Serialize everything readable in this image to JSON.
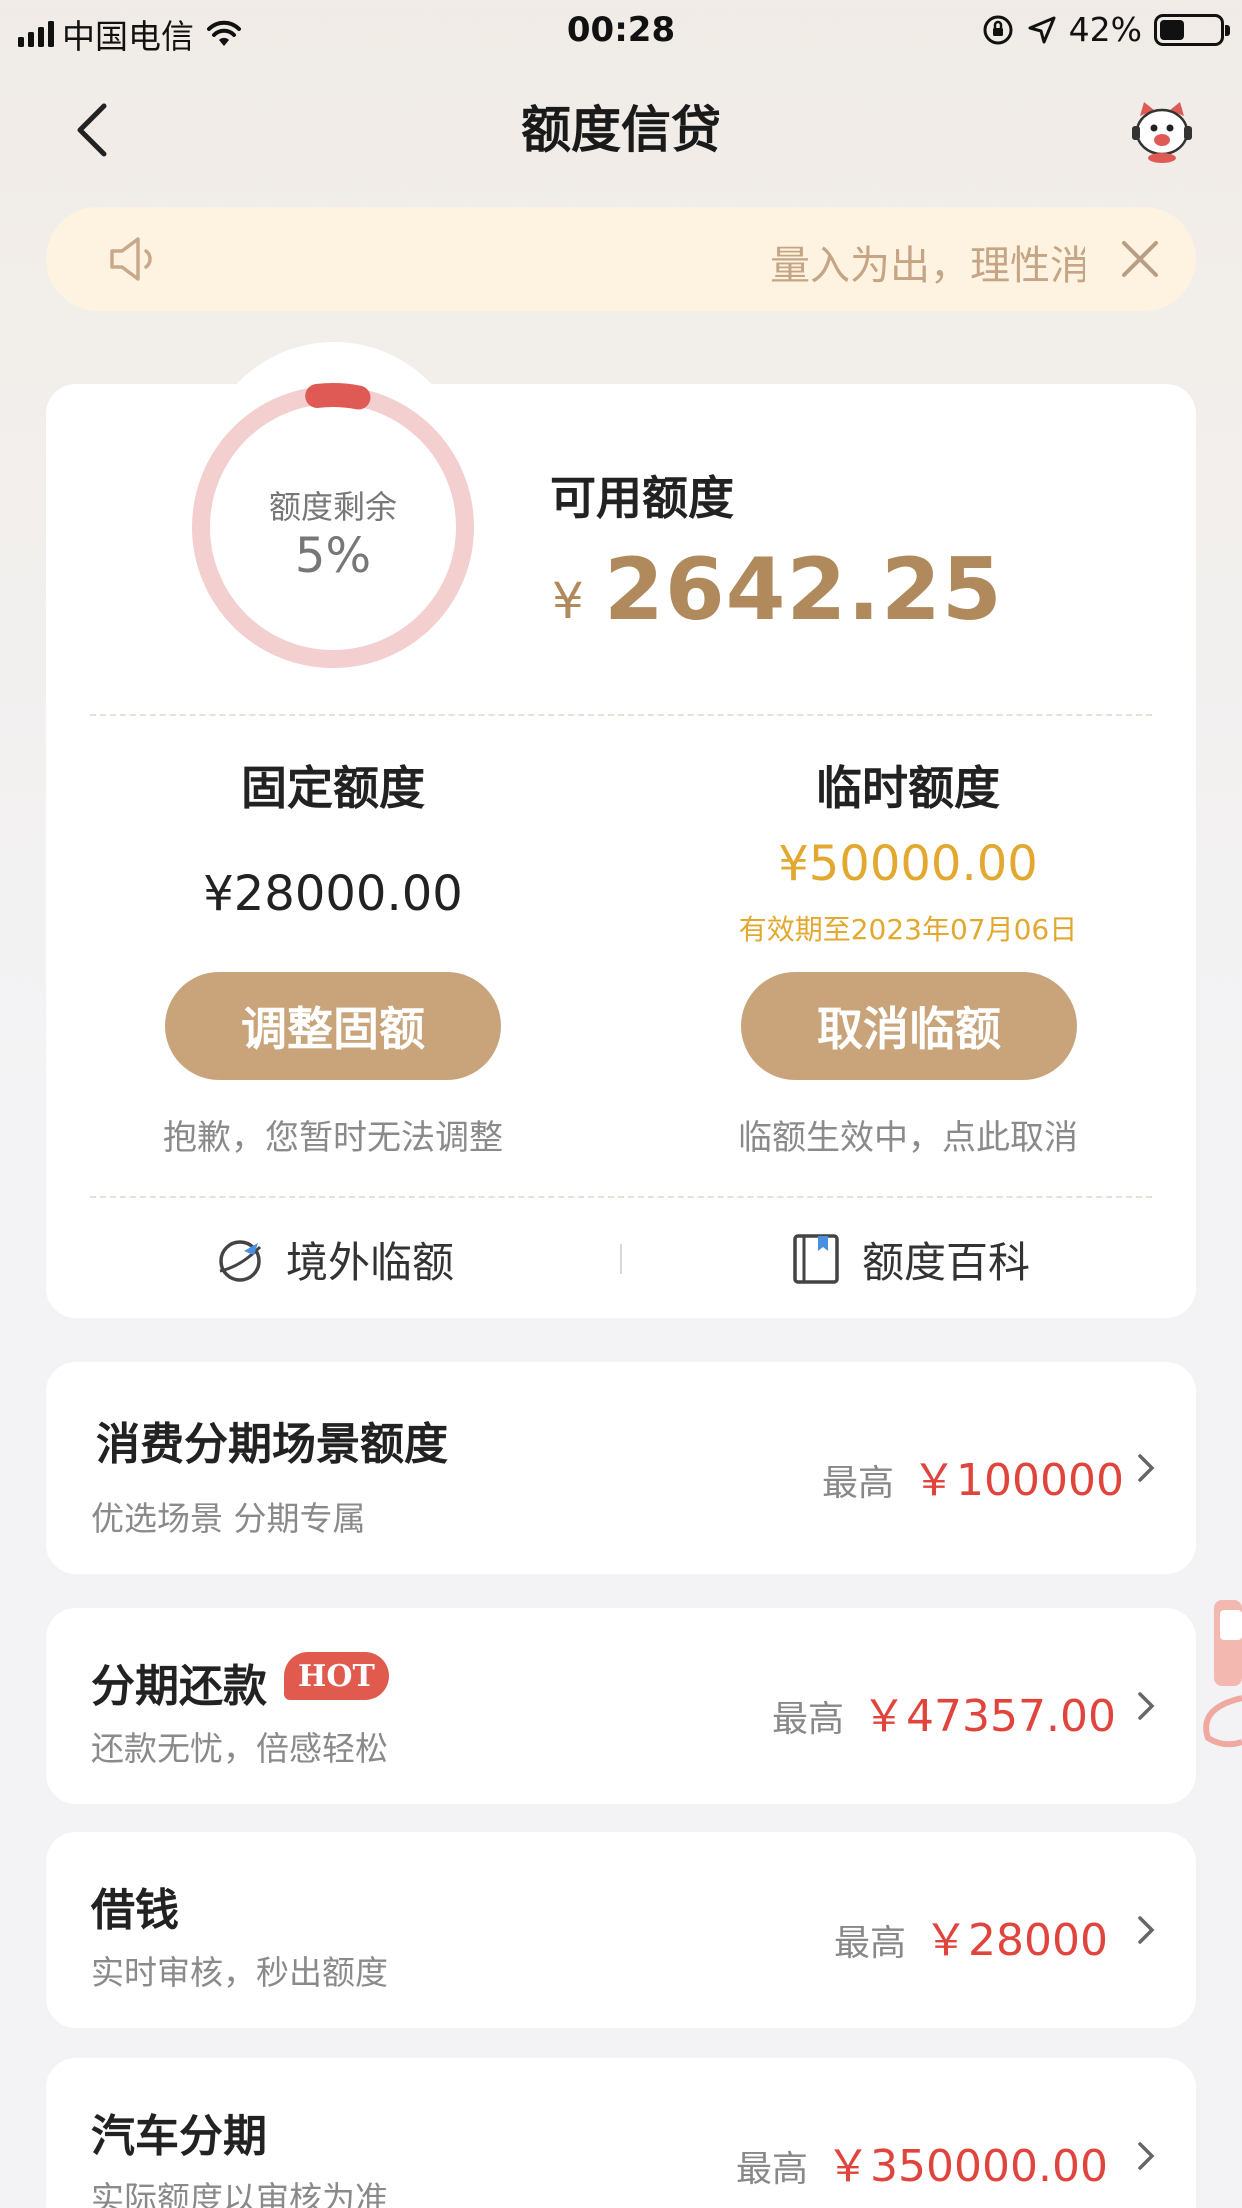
{
  "status_bar": {
    "carrier": "中国电信",
    "time": "00:28",
    "battery": "42%",
    "battery_level": 0.42
  },
  "nav": {
    "title": "额度信贷",
    "back_icon": "chevron-left-icon",
    "mascot_icon": "mascot-icon"
  },
  "notice": {
    "text": "量入为出，理性消费",
    "speaker_icon": "speaker-icon",
    "close_icon": "close-icon"
  },
  "credit": {
    "ring_label": "额度剩余",
    "ring_value": "5%",
    "ring_fraction": 0.05,
    "available_label": "可用额度",
    "currency": "¥",
    "available_amount": "2642.25",
    "fixed": {
      "title": "固定额度",
      "amount": "¥28000.00",
      "button": "调整固额",
      "hint": "抱歉，您暂时无法调整"
    },
    "temporary": {
      "title": "临时额度",
      "amount": "¥50000.00",
      "expire": "有效期至2023年07月06日",
      "button": "取消临额",
      "hint": "临额生效中，点此取消"
    },
    "links": [
      {
        "label": "境外临额",
        "icon": "globe-plane-icon"
      },
      {
        "label": "额度百科",
        "icon": "book-icon"
      }
    ]
  },
  "products": [
    {
      "title": "消费分期场景额度",
      "subtitle": "优选场景 分期专属",
      "prefix": "最高",
      "amount": "￥100000",
      "badge": ""
    },
    {
      "title": "分期还款",
      "subtitle": "还款无忧，倍感轻松",
      "prefix": "最高",
      "amount": "￥47357.00",
      "badge": "HOT"
    },
    {
      "title": "借钱",
      "subtitle": "实时审核，秒出额度",
      "prefix": "最高",
      "amount": "￥28000",
      "badge": ""
    },
    {
      "title": "汽车分期",
      "subtitle": "实际额度以审核为准",
      "prefix": "最高",
      "amount": "￥350000.00",
      "badge": ""
    }
  ],
  "colors": {
    "accent_gold": "#b08a5c",
    "button_gold": "#c9a47a",
    "temp_yellow": "#e2a82f",
    "amount_red": "#e0453d",
    "ring_track": "#f3cfcf",
    "ring_progress": "#e05a55"
  }
}
